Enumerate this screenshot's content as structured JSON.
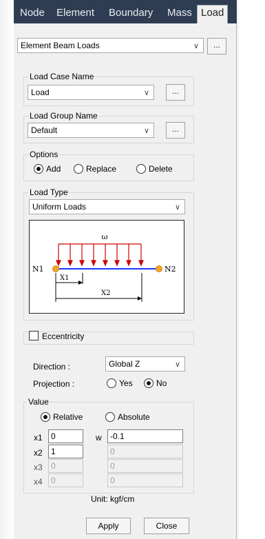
{
  "tabs": [
    "Node",
    "Element",
    "Boundary",
    "Mass",
    "Load"
  ],
  "active_tab": "Load",
  "command": {
    "value": "Element Beam Loads",
    "button": "..."
  },
  "load_case": {
    "label": "Load Case Name",
    "value": "Load",
    "button": "..."
  },
  "load_group": {
    "label": "Load Group Name",
    "value": "Default",
    "button": "..."
  },
  "options": {
    "label": "Options",
    "items": [
      "Add",
      "Replace",
      "Delete"
    ],
    "selected": "Add"
  },
  "load_type": {
    "label": "Load Type",
    "value": "Uniform Loads",
    "diagram": {
      "w": "ω",
      "n1": "N1",
      "n2": "N2",
      "x1": "X1",
      "x2": "X2"
    }
  },
  "eccentricity": {
    "label": "Eccentricity",
    "checked": false
  },
  "direction": {
    "label": "Direction  :",
    "value": "Global Z"
  },
  "projection": {
    "label": "Projection :",
    "yes": "Yes",
    "no": "No",
    "selected": "No"
  },
  "value": {
    "label": "Value",
    "relative": "Relative",
    "absolute": "Absolute",
    "selected": "Relative",
    "x_labels": [
      "x1",
      "x2",
      "x3",
      "x4"
    ],
    "x_values": [
      "0",
      "1",
      "0",
      "0"
    ],
    "w_label": "w",
    "w_values": [
      "-0.1",
      "0",
      "0",
      "0"
    ]
  },
  "unit": "Unit:  kgf/cm",
  "buttons": {
    "apply": "Apply",
    "close": "Close"
  },
  "colors": {
    "tabbar": "#2f3d52",
    "load_arrow": "#cc0000",
    "beam": "#1a3cff",
    "node": "#f5a623"
  }
}
